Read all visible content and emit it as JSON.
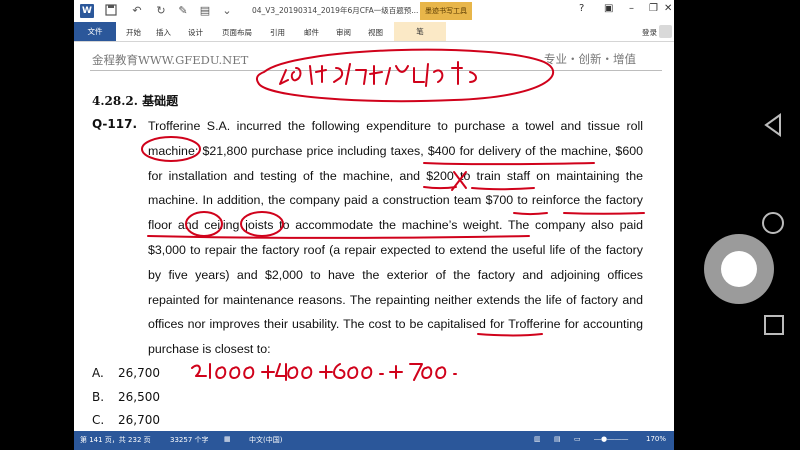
{
  "window": {
    "title": "04_V3_20190314_2019年6月CFA一级百题预...",
    "tools_badge": "墨迹书写工具",
    "login": "登录"
  },
  "ribbon": {
    "file": "文件",
    "tabs": [
      "开始",
      "插入",
      "设计",
      "页面布局",
      "引用",
      "邮件",
      "审阅",
      "视图"
    ],
    "pen": "笔"
  },
  "document": {
    "header_left": "金程教育WWW.GFEDU.NET",
    "header_right": "专业・创新・增值",
    "section": "4.28.2.  基础题",
    "question_label": "Q-117.",
    "question_text": "Trofferine S.A. incurred the following expenditure to purchase a towel and tissue roll machine: $21,800 purchase price including taxes, $400 for delivery of the machine, $600 for installation and testing of the machine, and $200 to train staff on maintaining the machine. In addition, the company paid a construction team $700 to reinforce the factory floor and ceiling joists to accommodate the machine’s weight. The company also paid $3,000 to repair the factory roof (a repair expected to extend the useful life of the factory by five years) and $2,000 to have the exterior of the factory and adjoining offices repainted for maintenance reasons. The repainting neither extends the life of factory and offices nor improves their usability. The cost to be capitalised for Trofferine for accounting purchase is closest to:",
    "options": [
      {
        "letter": "A.",
        "value": "26,700"
      },
      {
        "letter": "B.",
        "value": "26,500"
      },
      {
        "letter": "C.",
        "value": "26,700"
      }
    ],
    "ink_colors": {
      "red": "#d0021b"
    }
  },
  "status": {
    "page": "第 141 页，共 232 页",
    "words": "33257 个字",
    "language": "中文(中国)",
    "zoom": "170%"
  }
}
